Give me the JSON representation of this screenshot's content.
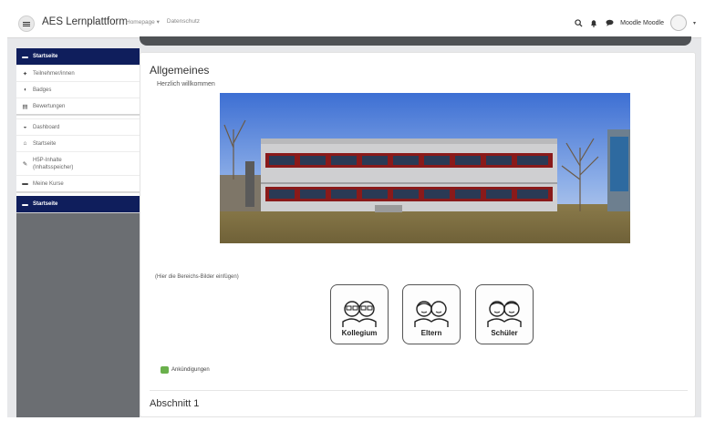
{
  "header": {
    "brand": "AES Lernplattform",
    "nav": [
      "Homepage ▾",
      "Datenschutz"
    ],
    "user_name": "Moodle Moodle",
    "icons": [
      "search-icon",
      "bell-icon",
      "chat-icon"
    ]
  },
  "sidebar": {
    "group1": [
      {
        "label": "Startseite",
        "icon": "graduation-icon",
        "active": true
      },
      {
        "label": "Teilnehmer/innen",
        "icon": "users-icon"
      },
      {
        "label": "Badges",
        "icon": "shield-icon"
      },
      {
        "label": "Bewertungen",
        "icon": "table-icon"
      }
    ],
    "group2": [
      {
        "label": "Dashboard",
        "icon": "dashboard-icon"
      },
      {
        "label": "Startseite",
        "icon": "home-icon"
      },
      {
        "label": "H5P-Inhalte (Inhaltsspeicher)",
        "icon": "pencil-icon"
      },
      {
        "label": "Meine Kurse",
        "icon": "graduation-icon"
      }
    ],
    "group3": [
      {
        "label": "Startseite",
        "icon": "graduation-icon",
        "active": true
      }
    ]
  },
  "main": {
    "section_title": "Allgemeines",
    "welcome": "Herzlich willkommen",
    "placeholder": "(Hier die Bereichs-Bilder einfügen)",
    "tiles": [
      "Kollegium",
      "Eltern",
      "Schüler"
    ],
    "announcements": "Ankündigungen",
    "section2_title": "Abschnitt 1"
  },
  "colors": {
    "sidebar_bg": "#6b6e72",
    "active_item": "#0f1e5c",
    "page_bg": "#e7e8ea"
  }
}
